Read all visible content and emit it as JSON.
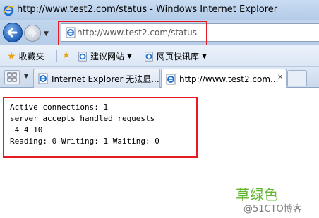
{
  "window": {
    "title": "http://www.test2.com/status - Windows Internet Explorer"
  },
  "nav": {
    "address": "http://www.test2.com/status"
  },
  "favorites_bar": {
    "favorites_label": "收藏夹",
    "items": [
      {
        "label": "建议网站"
      },
      {
        "label": "网页快讯库"
      }
    ]
  },
  "tabs": [
    {
      "label": "Internet Explorer 无法显...",
      "active": false
    },
    {
      "label": "http://www.test2.com...",
      "active": true
    }
  ],
  "page": {
    "lines": [
      "Active connections: 1",
      "server accepts handled requests",
      " 4 4 10",
      "Reading: 0 Writing: 1 Waiting: 0"
    ]
  },
  "watermark": {
    "text": "草绿色",
    "blog": "@51CTO博客"
  },
  "colors": {
    "highlight": "#e41b23",
    "titlebar": "#b3cbe8",
    "watermark": "#5fb82f"
  }
}
